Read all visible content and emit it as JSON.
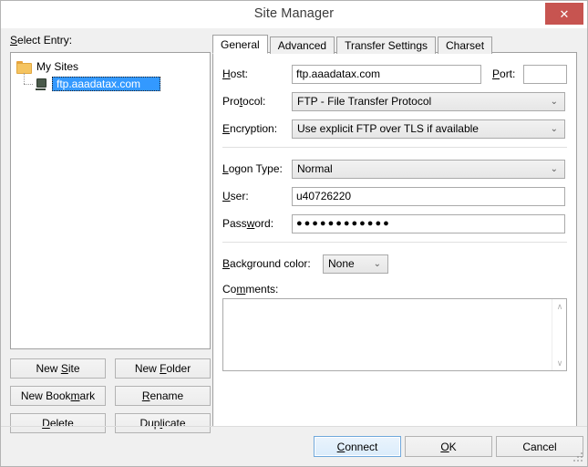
{
  "window": {
    "title": "Site Manager",
    "close_label": "✕",
    "accent_close": "#c75450",
    "accent_selection": "#3399ff",
    "accent_default_button": "#6fa8dc"
  },
  "left": {
    "select_entry_label": "Select Entry:",
    "tree": [
      {
        "label": "My Sites",
        "icon": "folder-icon",
        "selected": false,
        "level": 0
      },
      {
        "label": "ftp.aaadatax.com",
        "icon": "server-icon",
        "selected": true,
        "level": 1
      }
    ],
    "buttons": [
      {
        "label": "New Site",
        "name": "new-site-button"
      },
      {
        "label": "New Folder",
        "name": "new-folder-button"
      },
      {
        "label": "New Bookmark",
        "name": "new-bookmark-button"
      },
      {
        "label": "Rename",
        "name": "rename-button"
      },
      {
        "label": "Delete",
        "name": "delete-button"
      },
      {
        "label": "Duplicate",
        "name": "duplicate-button"
      }
    ]
  },
  "tabs": [
    {
      "label": "General",
      "active": true
    },
    {
      "label": "Advanced",
      "active": false
    },
    {
      "label": "Transfer Settings",
      "active": false
    },
    {
      "label": "Charset",
      "active": false
    }
  ],
  "general": {
    "host_label": "Host:",
    "host_value": "ftp.aaadatax.com",
    "host_placeholder": "",
    "port_label": "Port:",
    "port_value": "",
    "port_placeholder": "",
    "protocol_label": "Protocol:",
    "protocol_value": "FTP - File Transfer Protocol",
    "encryption_label": "Encryption:",
    "encryption_value": "Use explicit FTP over TLS if available",
    "logon_type_label": "Logon Type:",
    "logon_type_value": "Normal",
    "user_label": "User:",
    "user_value": "u40726220",
    "user_placeholder": "",
    "password_label": "Password:",
    "password_value": "●●●●●●●●●●●●",
    "password_placeholder": "",
    "background_color_label": "Background color:",
    "background_color_value": "None",
    "comments_label": "Comments:",
    "comments_value": "",
    "comments_placeholder": "",
    "dropdown_arrow": "⌄",
    "scroll_up_arrow": "∧",
    "scroll_down_arrow": "∨"
  },
  "footer": {
    "connect_label": "Connect",
    "ok_label": "OK",
    "cancel_label": "Cancel"
  }
}
